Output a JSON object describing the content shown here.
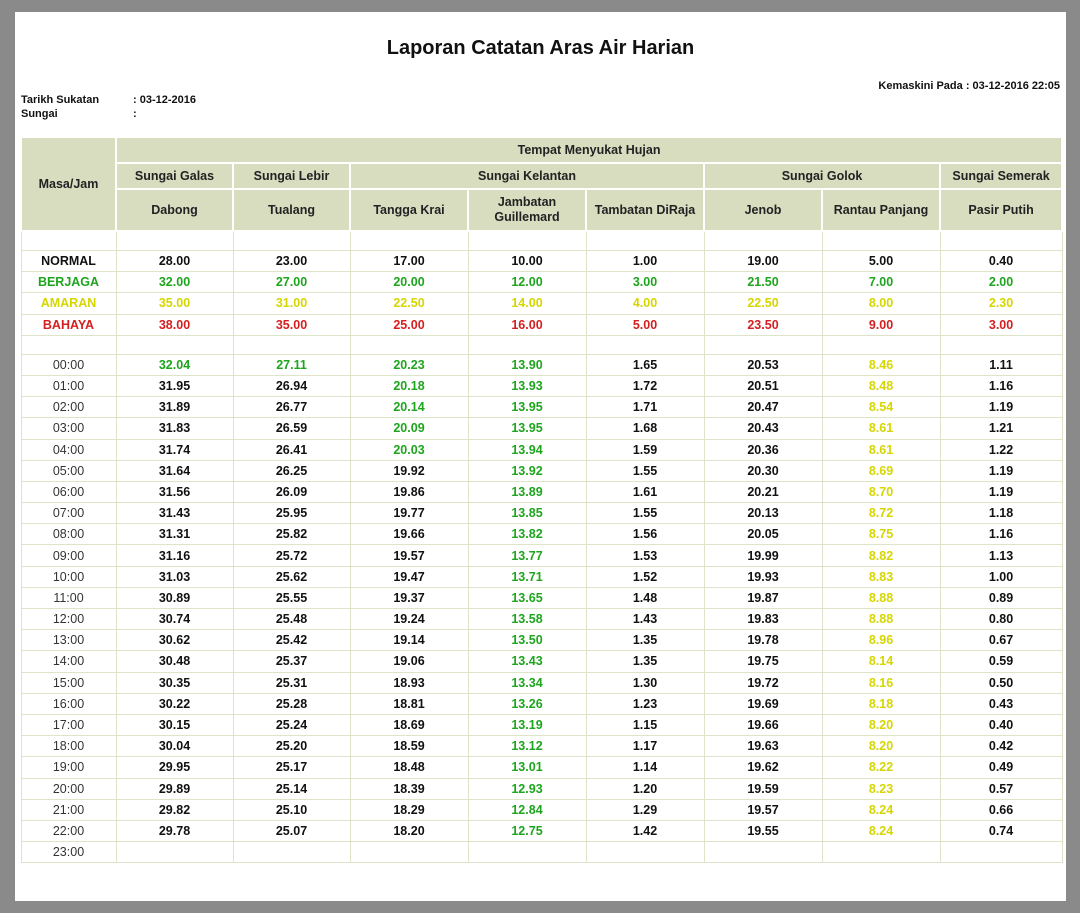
{
  "title": "Laporan Catatan Aras Air Harian",
  "updated": "Kemaskini Pada : 03-12-2016 22:05",
  "meta": {
    "date_label": "Tarikh Sukatan",
    "date_value": ": 03-12-2016",
    "river_label": "Sungai",
    "river_value": ":"
  },
  "colors": {
    "normal": "#111111",
    "berjaga": "#1ea51e",
    "amaran": "#d6d600",
    "bahaya": "#d42020",
    "header_bg": "#d8ddc0"
  },
  "header": {
    "time_col": "Masa/Jam",
    "group": "Tempat Menyukat Hujan",
    "rivers": [
      {
        "name": "Sungai Galas",
        "span": 1
      },
      {
        "name": "Sungai Lebir",
        "span": 1
      },
      {
        "name": "Sungai Kelantan",
        "span": 3
      },
      {
        "name": "Sungai Golok",
        "span": 2
      },
      {
        "name": "Sungai Semerak",
        "span": 1
      }
    ],
    "stations": [
      "Dabong",
      "Tualang",
      "Tangga Krai",
      "Jambatan Guillemard",
      "Tambatan DiRaja",
      "Jenob",
      "Rantau Panjang",
      "Pasir Putih"
    ]
  },
  "thresholds": [
    {
      "label": "NORMAL",
      "level": "normal",
      "values": [
        "28.00",
        "23.00",
        "17.00",
        "10.00",
        "1.00",
        "19.00",
        "5.00",
        "0.40"
      ]
    },
    {
      "label": "BERJAGA",
      "level": "berjaga",
      "values": [
        "32.00",
        "27.00",
        "20.00",
        "12.00",
        "3.00",
        "21.50",
        "7.00",
        "2.00"
      ]
    },
    {
      "label": "AMARAN",
      "level": "amaran",
      "values": [
        "35.00",
        "31.00",
        "22.50",
        "14.00",
        "4.00",
        "22.50",
        "8.00",
        "2.30"
      ]
    },
    {
      "label": "BAHAYA",
      "level": "bahaya",
      "values": [
        "38.00",
        "35.00",
        "25.00",
        "16.00",
        "5.00",
        "23.50",
        "9.00",
        "3.00"
      ]
    }
  ],
  "readings": [
    {
      "time": "00:00",
      "values": [
        "32.04",
        "27.11",
        "20.23",
        "13.90",
        "1.65",
        "20.53",
        "8.46",
        "1.11"
      ],
      "levels": [
        "berjaga",
        "berjaga",
        "berjaga",
        "berjaga",
        "normal",
        "normal",
        "amaran",
        "normal"
      ]
    },
    {
      "time": "01:00",
      "values": [
        "31.95",
        "26.94",
        "20.18",
        "13.93",
        "1.72",
        "20.51",
        "8.48",
        "1.16"
      ],
      "levels": [
        "normal",
        "normal",
        "berjaga",
        "berjaga",
        "normal",
        "normal",
        "amaran",
        "normal"
      ]
    },
    {
      "time": "02:00",
      "values": [
        "31.89",
        "26.77",
        "20.14",
        "13.95",
        "1.71",
        "20.47",
        "8.54",
        "1.19"
      ],
      "levels": [
        "normal",
        "normal",
        "berjaga",
        "berjaga",
        "normal",
        "normal",
        "amaran",
        "normal"
      ]
    },
    {
      "time": "03:00",
      "values": [
        "31.83",
        "26.59",
        "20.09",
        "13.95",
        "1.68",
        "20.43",
        "8.61",
        "1.21"
      ],
      "levels": [
        "normal",
        "normal",
        "berjaga",
        "berjaga",
        "normal",
        "normal",
        "amaran",
        "normal"
      ]
    },
    {
      "time": "04:00",
      "values": [
        "31.74",
        "26.41",
        "20.03",
        "13.94",
        "1.59",
        "20.36",
        "8.61",
        "1.22"
      ],
      "levels": [
        "normal",
        "normal",
        "berjaga",
        "berjaga",
        "normal",
        "normal",
        "amaran",
        "normal"
      ]
    },
    {
      "time": "05:00",
      "values": [
        "31.64",
        "26.25",
        "19.92",
        "13.92",
        "1.55",
        "20.30",
        "8.69",
        "1.19"
      ],
      "levels": [
        "normal",
        "normal",
        "normal",
        "berjaga",
        "normal",
        "normal",
        "amaran",
        "normal"
      ]
    },
    {
      "time": "06:00",
      "values": [
        "31.56",
        "26.09",
        "19.86",
        "13.89",
        "1.61",
        "20.21",
        "8.70",
        "1.19"
      ],
      "levels": [
        "normal",
        "normal",
        "normal",
        "berjaga",
        "normal",
        "normal",
        "amaran",
        "normal"
      ]
    },
    {
      "time": "07:00",
      "values": [
        "31.43",
        "25.95",
        "19.77",
        "13.85",
        "1.55",
        "20.13",
        "8.72",
        "1.18"
      ],
      "levels": [
        "normal",
        "normal",
        "normal",
        "berjaga",
        "normal",
        "normal",
        "amaran",
        "normal"
      ]
    },
    {
      "time": "08:00",
      "values": [
        "31.31",
        "25.82",
        "19.66",
        "13.82",
        "1.56",
        "20.05",
        "8.75",
        "1.16"
      ],
      "levels": [
        "normal",
        "normal",
        "normal",
        "berjaga",
        "normal",
        "normal",
        "amaran",
        "normal"
      ]
    },
    {
      "time": "09:00",
      "values": [
        "31.16",
        "25.72",
        "19.57",
        "13.77",
        "1.53",
        "19.99",
        "8.82",
        "1.13"
      ],
      "levels": [
        "normal",
        "normal",
        "normal",
        "berjaga",
        "normal",
        "normal",
        "amaran",
        "normal"
      ]
    },
    {
      "time": "10:00",
      "values": [
        "31.03",
        "25.62",
        "19.47",
        "13.71",
        "1.52",
        "19.93",
        "8.83",
        "1.00"
      ],
      "levels": [
        "normal",
        "normal",
        "normal",
        "berjaga",
        "normal",
        "normal",
        "amaran",
        "normal"
      ]
    },
    {
      "time": "11:00",
      "values": [
        "30.89",
        "25.55",
        "19.37",
        "13.65",
        "1.48",
        "19.87",
        "8.88",
        "0.89"
      ],
      "levels": [
        "normal",
        "normal",
        "normal",
        "berjaga",
        "normal",
        "normal",
        "amaran",
        "normal"
      ]
    },
    {
      "time": "12:00",
      "values": [
        "30.74",
        "25.48",
        "19.24",
        "13.58",
        "1.43",
        "19.83",
        "8.88",
        "0.80"
      ],
      "levels": [
        "normal",
        "normal",
        "normal",
        "berjaga",
        "normal",
        "normal",
        "amaran",
        "normal"
      ]
    },
    {
      "time": "13:00",
      "values": [
        "30.62",
        "25.42",
        "19.14",
        "13.50",
        "1.35",
        "19.78",
        "8.96",
        "0.67"
      ],
      "levels": [
        "normal",
        "normal",
        "normal",
        "berjaga",
        "normal",
        "normal",
        "amaran",
        "normal"
      ]
    },
    {
      "time": "14:00",
      "values": [
        "30.48",
        "25.37",
        "19.06",
        "13.43",
        "1.35",
        "19.75",
        "8.14",
        "0.59"
      ],
      "levels": [
        "normal",
        "normal",
        "normal",
        "berjaga",
        "normal",
        "normal",
        "amaran",
        "normal"
      ]
    },
    {
      "time": "15:00",
      "values": [
        "30.35",
        "25.31",
        "18.93",
        "13.34",
        "1.30",
        "19.72",
        "8.16",
        "0.50"
      ],
      "levels": [
        "normal",
        "normal",
        "normal",
        "berjaga",
        "normal",
        "normal",
        "amaran",
        "normal"
      ]
    },
    {
      "time": "16:00",
      "values": [
        "30.22",
        "25.28",
        "18.81",
        "13.26",
        "1.23",
        "19.69",
        "8.18",
        "0.43"
      ],
      "levels": [
        "normal",
        "normal",
        "normal",
        "berjaga",
        "normal",
        "normal",
        "amaran",
        "normal"
      ]
    },
    {
      "time": "17:00",
      "values": [
        "30.15",
        "25.24",
        "18.69",
        "13.19",
        "1.15",
        "19.66",
        "8.20",
        "0.40"
      ],
      "levels": [
        "normal",
        "normal",
        "normal",
        "berjaga",
        "normal",
        "normal",
        "amaran",
        "normal"
      ]
    },
    {
      "time": "18:00",
      "values": [
        "30.04",
        "25.20",
        "18.59",
        "13.12",
        "1.17",
        "19.63",
        "8.20",
        "0.42"
      ],
      "levels": [
        "normal",
        "normal",
        "normal",
        "berjaga",
        "normal",
        "normal",
        "amaran",
        "normal"
      ]
    },
    {
      "time": "19:00",
      "values": [
        "29.95",
        "25.17",
        "18.48",
        "13.01",
        "1.14",
        "19.62",
        "8.22",
        "0.49"
      ],
      "levels": [
        "normal",
        "normal",
        "normal",
        "berjaga",
        "normal",
        "normal",
        "amaran",
        "normal"
      ]
    },
    {
      "time": "20:00",
      "values": [
        "29.89",
        "25.14",
        "18.39",
        "12.93",
        "1.20",
        "19.59",
        "8.23",
        "0.57"
      ],
      "levels": [
        "normal",
        "normal",
        "normal",
        "berjaga",
        "normal",
        "normal",
        "amaran",
        "normal"
      ]
    },
    {
      "time": "21:00",
      "values": [
        "29.82",
        "25.10",
        "18.29",
        "12.84",
        "1.29",
        "19.57",
        "8.24",
        "0.66"
      ],
      "levels": [
        "normal",
        "normal",
        "normal",
        "berjaga",
        "normal",
        "normal",
        "amaran",
        "normal"
      ]
    },
    {
      "time": "22:00",
      "values": [
        "29.78",
        "25.07",
        "18.20",
        "12.75",
        "1.42",
        "19.55",
        "8.24",
        "0.74"
      ],
      "levels": [
        "normal",
        "normal",
        "normal",
        "berjaga",
        "normal",
        "normal",
        "amaran",
        "normal"
      ]
    },
    {
      "time": "23:00",
      "values": [
        "",
        "",
        "",
        "",
        "",
        "",
        "",
        ""
      ],
      "levels": [
        "normal",
        "normal",
        "normal",
        "normal",
        "normal",
        "normal",
        "normal",
        "normal"
      ]
    }
  ]
}
